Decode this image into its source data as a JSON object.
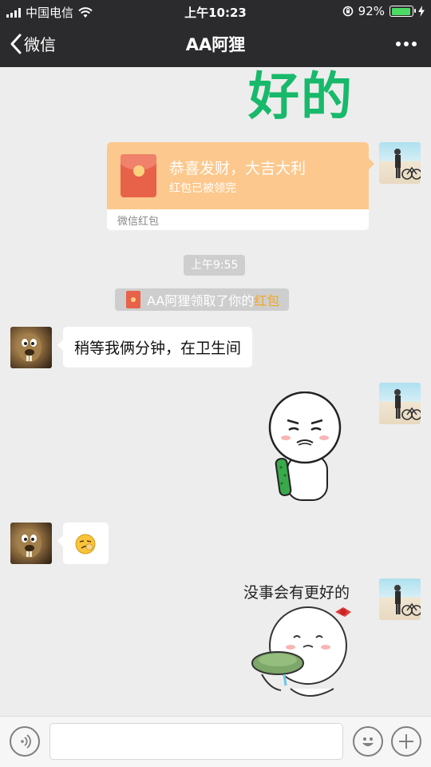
{
  "status_bar": {
    "carrier": "中国电信",
    "time": "上午10:23",
    "battery": "92%",
    "battery_level": 0.92
  },
  "nav": {
    "back_label": "微信",
    "title": "AA阿狸"
  },
  "messages": {
    "sticker_haode_text": "好的",
    "red_packet": {
      "title": "恭喜发财，大吉大利",
      "status": "红包已被领完",
      "footer": "微信红包"
    },
    "timestamp": "上午9:55",
    "system_notice": {
      "prefix": "AA阿狸领取了你的",
      "highlight": "红包"
    },
    "text_message": "稍等我俩分钟，在卫生间",
    "sticker_last_caption": "没事会有更好的"
  },
  "colors": {
    "nav_bg": "#2b2b2d",
    "chat_bg": "#ededed",
    "red_packet": "#fcc88d",
    "sticker_green": "#18b96b",
    "highlight": "#f5a623"
  },
  "icons": {
    "voice": "voice-icon",
    "emoji": "emoji-icon",
    "plus": "plus-icon"
  }
}
